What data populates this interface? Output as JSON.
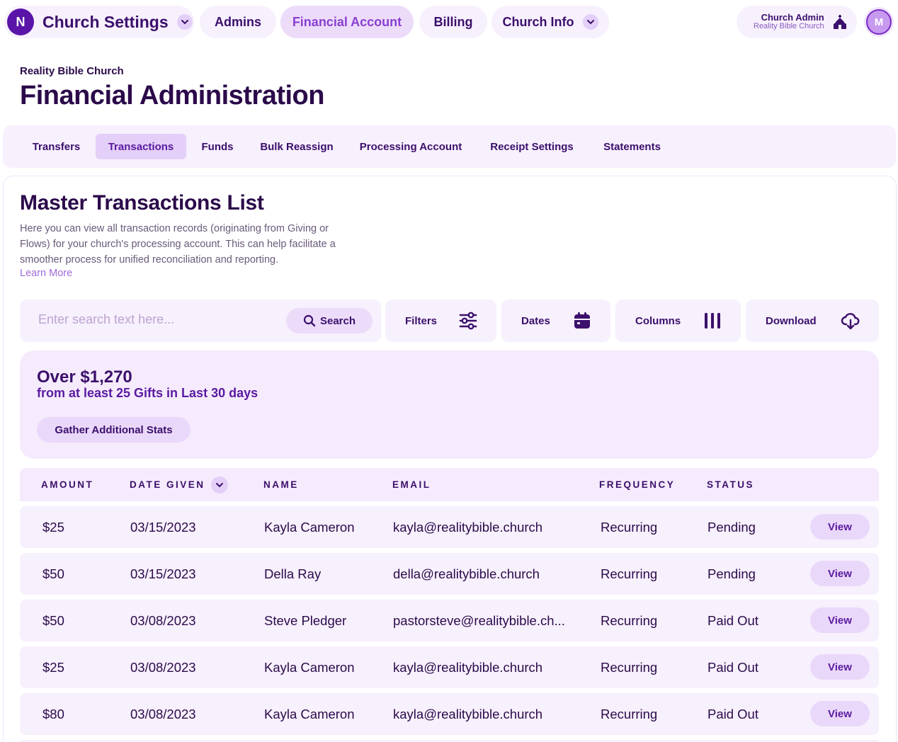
{
  "topnav": {
    "logo_letter": "N",
    "brand_title": "Church Settings",
    "tabs": [
      {
        "label": "Admins"
      },
      {
        "label": "Financial Account"
      },
      {
        "label": "Billing"
      },
      {
        "label": "Church Info"
      }
    ],
    "account": {
      "name": "Church Admin",
      "church": "Reality Bible Church"
    },
    "avatar_initial": "M"
  },
  "header": {
    "church": "Reality Bible Church",
    "title": "Financial Administration"
  },
  "subtabs": [
    {
      "label": "Transfers"
    },
    {
      "label": "Transactions"
    },
    {
      "label": "Funds"
    },
    {
      "label": "Bulk Reassign"
    },
    {
      "label": "Processing Account"
    },
    {
      "label": "Receipt Settings"
    },
    {
      "label": "Statements"
    }
  ],
  "main": {
    "title": "Master Transactions List",
    "description": "Here you can view all transaction records (originating from Giving or Flows) for your church's processing account. This can help facilitate a smoother process for unified reconciliation and reporting.",
    "learn_more": "Learn More"
  },
  "toolbar": {
    "search_placeholder": "Enter search text here...",
    "search_label": "Search",
    "filters_label": "Filters",
    "dates_label": "Dates",
    "columns_label": "Columns",
    "download_label": "Download"
  },
  "stats": {
    "amount": "Over $1,270",
    "subtitle": "from at least 25 Gifts in Last 30 days",
    "gather_label": "Gather Additional Stats"
  },
  "table": {
    "headers": {
      "amount": "AMOUNT",
      "date": "DATE GIVEN",
      "name": "NAME",
      "email": "EMAIL",
      "frequency": "FREQUENCY",
      "status": "STATUS"
    },
    "view_label": "View",
    "rows": [
      {
        "amount": "$25",
        "date": "03/15/2023",
        "name": "Kayla Cameron",
        "email": "kayla@realitybible.church",
        "frequency": "Recurring",
        "status": "Pending"
      },
      {
        "amount": "$50",
        "date": "03/15/2023",
        "name": "Della Ray",
        "email": "della@realitybible.church",
        "frequency": "Recurring",
        "status": "Pending"
      },
      {
        "amount": "$50",
        "date": "03/08/2023",
        "name": "Steve Pledger",
        "email": "pastorsteve@realitybible.ch...",
        "frequency": "Recurring",
        "status": "Paid Out"
      },
      {
        "amount": "$25",
        "date": "03/08/2023",
        "name": "Kayla Cameron",
        "email": "kayla@realitybible.church",
        "frequency": "Recurring",
        "status": "Paid Out"
      },
      {
        "amount": "$80",
        "date": "03/08/2023",
        "name": "Kayla Cameron",
        "email": "kayla@realitybible.church",
        "frequency": "Recurring",
        "status": "Paid Out"
      }
    ]
  },
  "colors": {
    "primary": "#3b0f6b",
    "accent": "#8a3fd1",
    "surface": "#f7f0fd",
    "active": "#ecdcfa"
  }
}
